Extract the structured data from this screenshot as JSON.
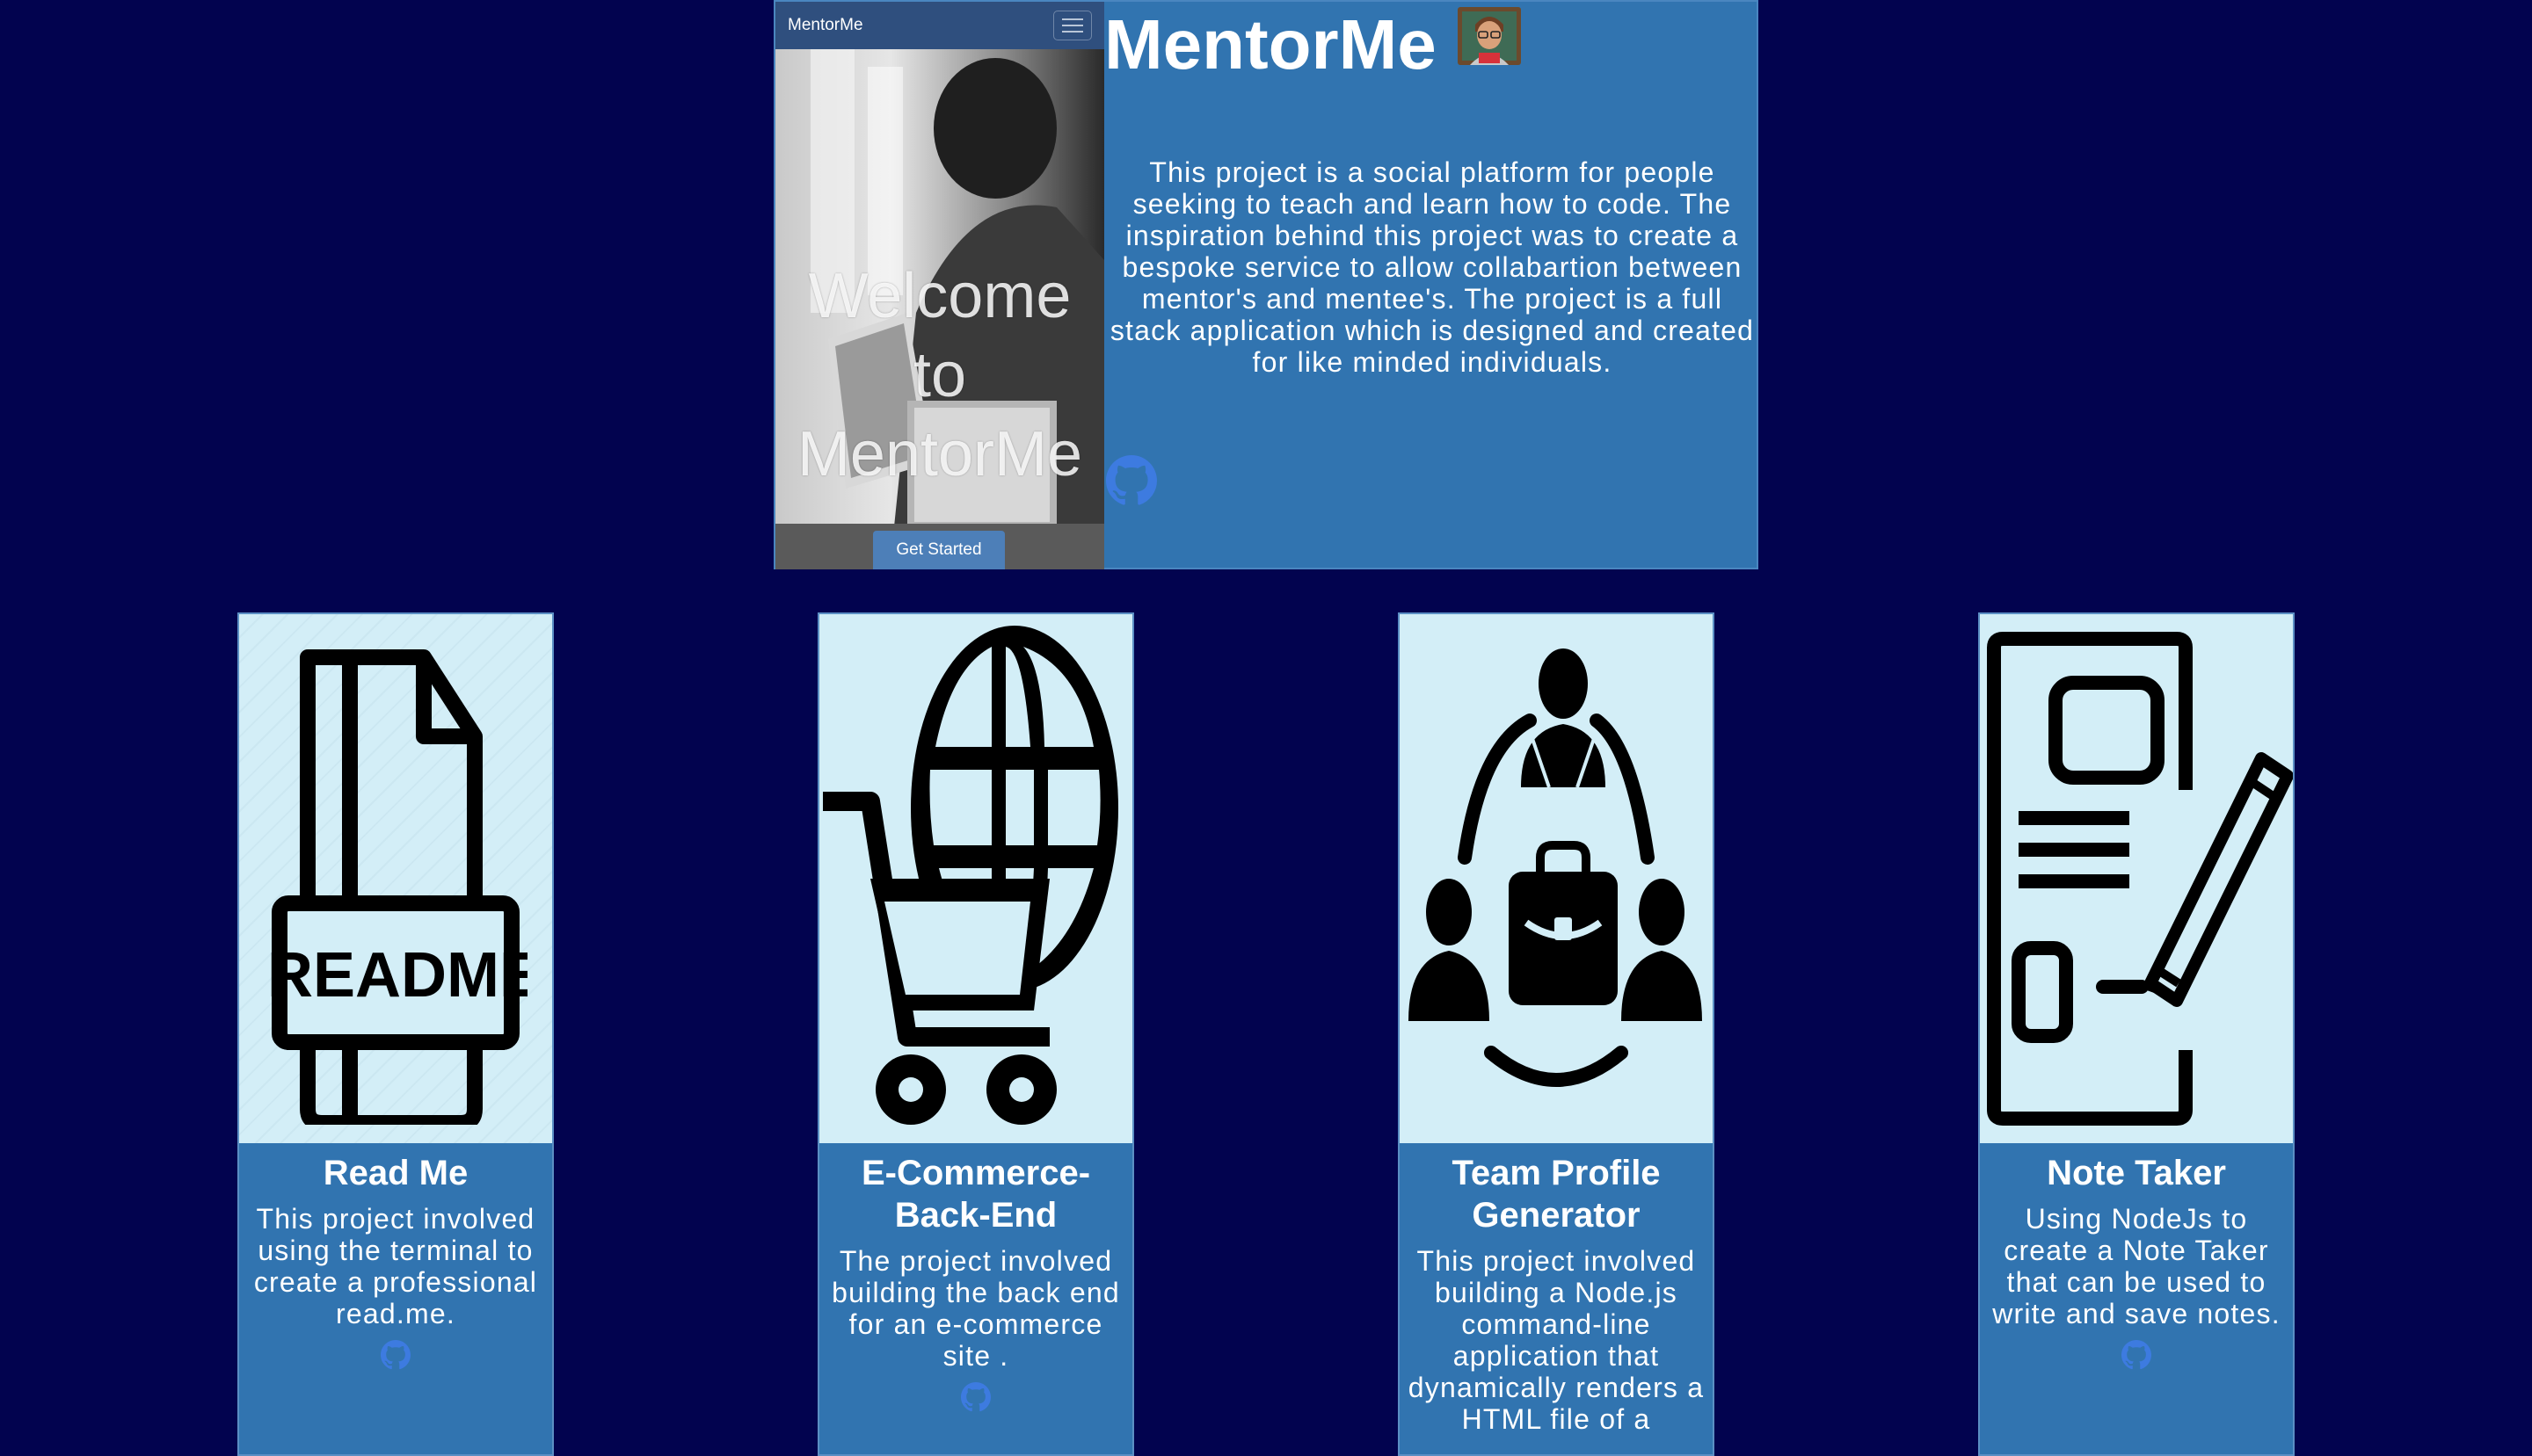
{
  "featured": {
    "nav_brand": "MentorMe",
    "menu_icon": "hamburger-menu-icon",
    "welcome": "Welcome to MentorMe",
    "get_started": "Get Started",
    "title": "MentorMe",
    "title_emoji": "teacher-emoji-icon",
    "description": "This project is a social platform for people seeking to teach and learn how to code. The inspiration behind this project was to create a bespoke service to allow collabartion between mentor's and mentee's. The project is a full stack application which is designed and created for like minded individuals.",
    "repo_icon": "github-icon"
  },
  "cards": [
    {
      "image_icon": "readme-file-icon",
      "image_text": ".README",
      "title": "Read Me",
      "description": "This project involved using the terminal to create a professional read.me.",
      "repo_icon": "github-icon"
    },
    {
      "image_icon": "shopping-cart-globe-icon",
      "title": "E-Commerce-Back-End",
      "description": "The project involved building the back end for an e-commerce site .",
      "repo_icon": "github-icon"
    },
    {
      "image_icon": "team-network-icon",
      "title": "Team Profile Generator",
      "description": "This project involved building a Node.js command-line application that dynamically renders a HTML file of a",
      "repo_icon": "github-icon"
    },
    {
      "image_icon": "notepad-pencil-icon",
      "title": "Note Taker",
      "description": "Using NodeJs to create a Note Taker that can be used to write and save notes.",
      "repo_icon": "github-icon"
    }
  ],
  "colors": {
    "page_background": "#02034f",
    "panel_blue": "#3174b0",
    "card_image_background": "#d3eef7",
    "github_icon": "#3d7be0"
  }
}
